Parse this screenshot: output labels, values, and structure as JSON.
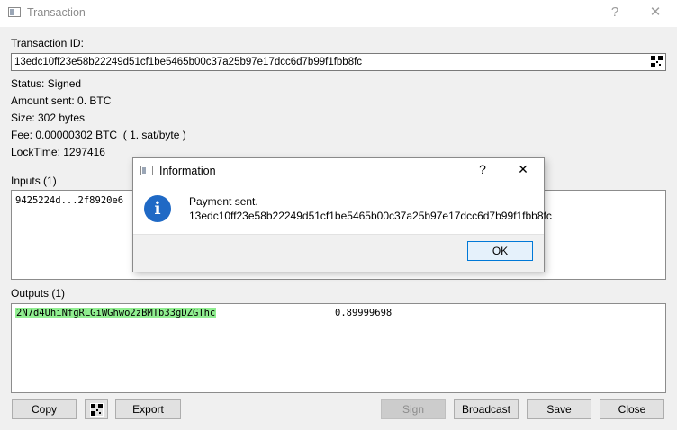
{
  "window": {
    "title": "Transaction",
    "help": "?",
    "close": "✕"
  },
  "txid": {
    "label": "Transaction ID:",
    "value": "13edc10ff23e58b22249d51cf1be5465b00c37a25b97e17dcc6d7b99f1fbb8fc"
  },
  "info": {
    "status": "Status: Signed",
    "amount": "Amount sent: 0. BTC",
    "size": "Size: 302 bytes",
    "fee": "Fee: 0.00000302 BTC  ( 1. sat/byte )",
    "locktime": "LockTime: 1297416"
  },
  "inputs": {
    "label": "Inputs (1)",
    "items": [
      "9425224d...2f8920e6"
    ]
  },
  "outputs": {
    "label": "Outputs (1)",
    "items": [
      {
        "address": "2N7d4UhiNfgRLGiWGhwo2zBMTb33gDZGThc",
        "amount": "0.89999698"
      }
    ]
  },
  "buttons": {
    "copy": "Copy",
    "export": "Export",
    "sign": "Sign",
    "broadcast": "Broadcast",
    "save": "Save",
    "close": "Close"
  },
  "dialog": {
    "title": "Information",
    "help": "?",
    "close": "✕",
    "message": "Payment sent.",
    "detail": "13edc10ff23e58b22249d51cf1be5465b00c37a25b97e17dcc6d7b99f1fbb8fc",
    "ok": "OK"
  },
  "colors": {
    "highlight": "#90ee90",
    "accent": "#0078d7",
    "info_icon": "#1f69c5"
  },
  "icons": {
    "window": "window-icon",
    "qr": "qr-code-icon",
    "info": "info-icon"
  }
}
